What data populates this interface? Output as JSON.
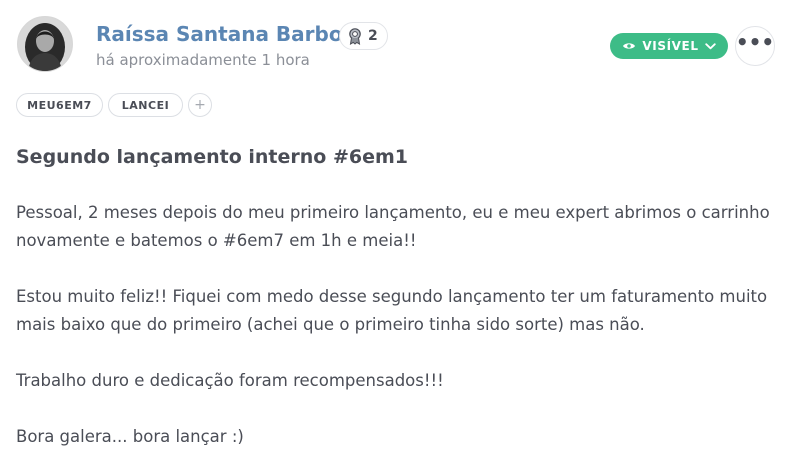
{
  "author": {
    "name": "Raíssa Santana Barbosa",
    "badge_count": "2",
    "timestamp": "há aproximadamente 1 hora"
  },
  "actions": {
    "visibility_label": "VISÍVEL",
    "more_label": "•••"
  },
  "tags": [
    {
      "label": "MEU6EM7"
    },
    {
      "label": "LANCEI"
    }
  ],
  "add_tag_label": "+",
  "post": {
    "title": "Segundo lançamento interno #6em1",
    "paragraphs": [
      "Pessoal, 2 meses depois do meu primeiro lançamento, eu e meu expert abrimos o carrinho novamente e batemos o #6em7 em 1h e meia!!",
      "Estou muito feliz!! Fiquei com medo desse segundo lançamento ter um faturamento muito mais baixo que do primeiro (achei que o primeiro tinha sido sorte) mas não.",
      "Trabalho duro e dedicação foram recompensados!!!",
      "Bora galera... bora lançar :)"
    ]
  },
  "colors": {
    "author_name": "#5b86b3",
    "visibility_button": "#3dbc87",
    "text": "#4a4d56",
    "muted_text": "#8b8f97",
    "border": "#dcdfe4"
  },
  "icons": {
    "badge": "award-ribbon-icon",
    "visibility": "eye-icon",
    "dropdown": "chevron-down-icon",
    "more": "more-horizontal-icon",
    "add_tag": "plus-icon"
  }
}
